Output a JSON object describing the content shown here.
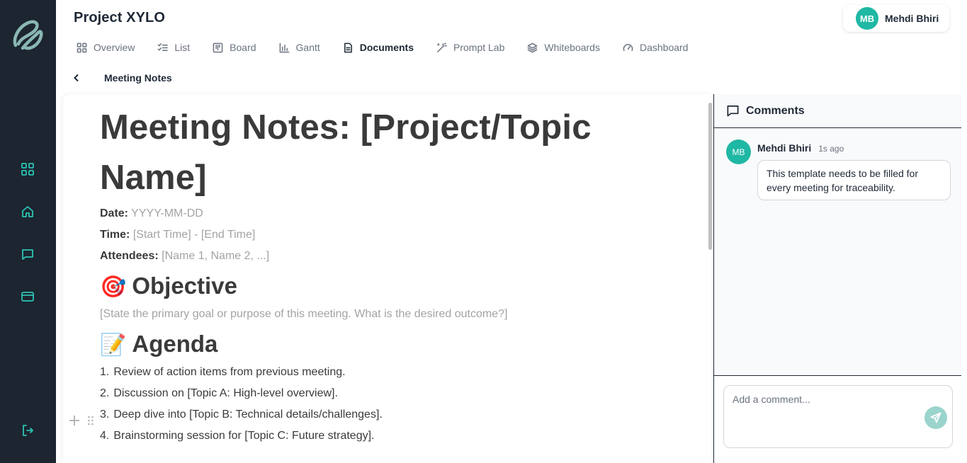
{
  "project": {
    "title": "Project XYLO"
  },
  "user": {
    "initials": "MB",
    "name": "Mehdi Bhiri"
  },
  "tabs": [
    {
      "label": "Overview",
      "icon": "grid-icon"
    },
    {
      "label": "List",
      "icon": "checklist-icon"
    },
    {
      "label": "Board",
      "icon": "board-icon"
    },
    {
      "label": "Gantt",
      "icon": "bar-chart-icon"
    },
    {
      "label": "Documents",
      "icon": "document-icon",
      "active": true
    },
    {
      "label": "Prompt Lab",
      "icon": "magic-wand-icon"
    },
    {
      "label": "Whiteboards",
      "icon": "layers-icon"
    },
    {
      "label": "Dashboard",
      "icon": "gauge-icon"
    }
  ],
  "breadcrumb": {
    "title": "Meeting Notes"
  },
  "document": {
    "title": "Meeting Notes: [Project/Topic Name]",
    "date_label": "Date:",
    "date_value": "YYYY-MM-DD",
    "time_label": "Time:",
    "time_value": "[Start Time] - [End Time]",
    "attendees_label": "Attendees:",
    "attendees_value": "[Name 1, Name 2, ...]",
    "objective_emoji": "🎯",
    "objective_heading": "Objective",
    "objective_text": "[State the primary goal or purpose of this meeting. What is the desired outcome?]",
    "agenda_emoji": "📝",
    "agenda_heading": "Agenda",
    "agenda_items": [
      {
        "num": "1.",
        "text": "Review of action items from previous meeting."
      },
      {
        "num": "2.",
        "text": "Discussion on [Topic A: High-level overview]."
      },
      {
        "num": "3.",
        "text": "Deep dive into [Topic B: Technical details/challenges]."
      },
      {
        "num": "4.",
        "text": "Brainstorming session for [Topic C: Future strategy]."
      }
    ]
  },
  "comments": {
    "title": "Comments",
    "items": [
      {
        "initials": "MB",
        "author": "Mehdi Bhiri",
        "time": "1s ago",
        "text": "This template needs to be filled for every meeting for traceability."
      }
    ],
    "input_placeholder": "Add a comment..."
  },
  "colors": {
    "sidebar_bg": "#1c2530",
    "accent": "#1fb8a4",
    "send_disabled": "#9ad4cc"
  }
}
